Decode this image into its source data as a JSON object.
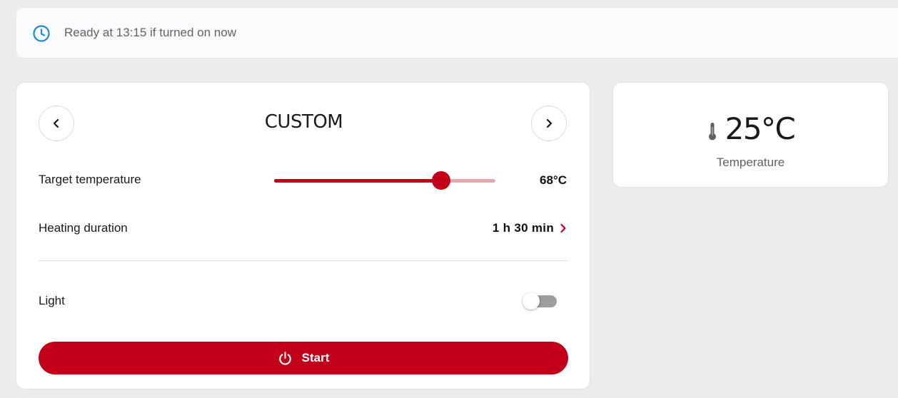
{
  "banner": {
    "icon": "clock-icon",
    "text": "Ready at 13:15 if turned on now",
    "accent_color": "#1f8ad2"
  },
  "program": {
    "title": "CUSTOM",
    "prev_icon": "chevron-left-icon",
    "next_icon": "chevron-right-icon",
    "target_temperature": {
      "label": "Target temperature",
      "value_text": "68°C",
      "slider_fraction": 0.755
    },
    "heating_duration": {
      "label": "Heating duration",
      "value_text": "1 h 30 min",
      "icon": "chevron-right-icon"
    },
    "light": {
      "label": "Light",
      "enabled": false
    },
    "start_button": {
      "label": "Start",
      "icon": "power-icon"
    }
  },
  "status": {
    "icon": "thermometer-icon",
    "current_temperature": "25°C",
    "caption": "Temperature"
  },
  "colors": {
    "brand_red": "#c3001a",
    "slider_inactive": "#eaa6ad",
    "toggle_off": "#9e9e9e",
    "background": "#ececec"
  }
}
